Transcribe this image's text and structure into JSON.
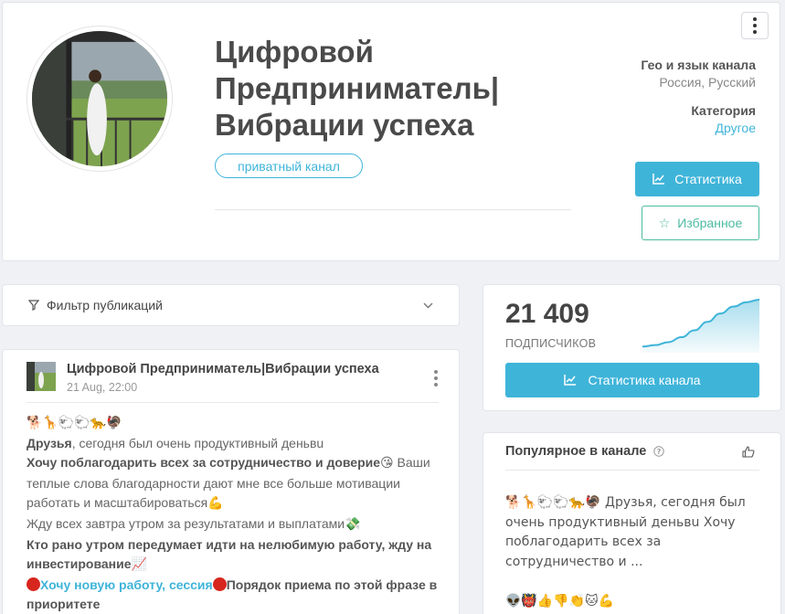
{
  "channel": {
    "title": "Цифровой Предприниматель| Вибрации успеха",
    "badge": "приватный канал",
    "geo_label": "Гео и язык канала",
    "geo_value": "Россия, Русский",
    "category_label": "Категория",
    "category_value": "Другое",
    "stats_button": "Статистика",
    "favorite_button": "Избранное"
  },
  "filter": {
    "label": "Фильтр публикаций"
  },
  "post": {
    "author": "Цифровой Предприниматель|Вибрации успеха",
    "date": "21 Aug, 22:00",
    "emoji_line": "🐕🦒🐑🐑🐆🦃",
    "line1_bold": "Друзья",
    "line1_rest": ", сегодня был очень продуктивный деньвu",
    "line2_bold": "Хочу поблагодарить всех за сотрудничество и доверие",
    "line2_emoji": "😘",
    "line2_rest": " Ваши теплые слова благодарности дают мне все больше мотивации работать и масштабироваться",
    "line2_emoji2": "💪",
    "line3": "Жду всех завтра утром за результатами и выплатами",
    "line3_emoji": "💸",
    "line4_bold": "Кто рано утром передумает идти на нелюбимую работу, жду на инвестирование",
    "line4_emoji": "📈",
    "line5_link": "Хочу новую работу, сессия",
    "line5_bold": "Порядок приема по этой фразе в приоритете"
  },
  "subscribers": {
    "count": "21 409",
    "label": "ПОДПИСЧИКОВ",
    "button": "Статистика канала",
    "trend": [
      0.05,
      0.08,
      0.14,
      0.24,
      0.38,
      0.55,
      0.72,
      0.86,
      0.95,
      1.0
    ]
  },
  "popular": {
    "title": "Популярное в канале",
    "snippet": "🐕🦒🐑🐑🐆🦃 Друзья, сегодня был очень продуктивный деньвu Хочу поблагодарить всех за сотрудничество и ...",
    "emojis": "👽👹👍👎👏🐱💪"
  },
  "colors": {
    "accent": "#3fb4d9",
    "favorite": "#4cbba1",
    "red_dot": "#d7261e"
  }
}
